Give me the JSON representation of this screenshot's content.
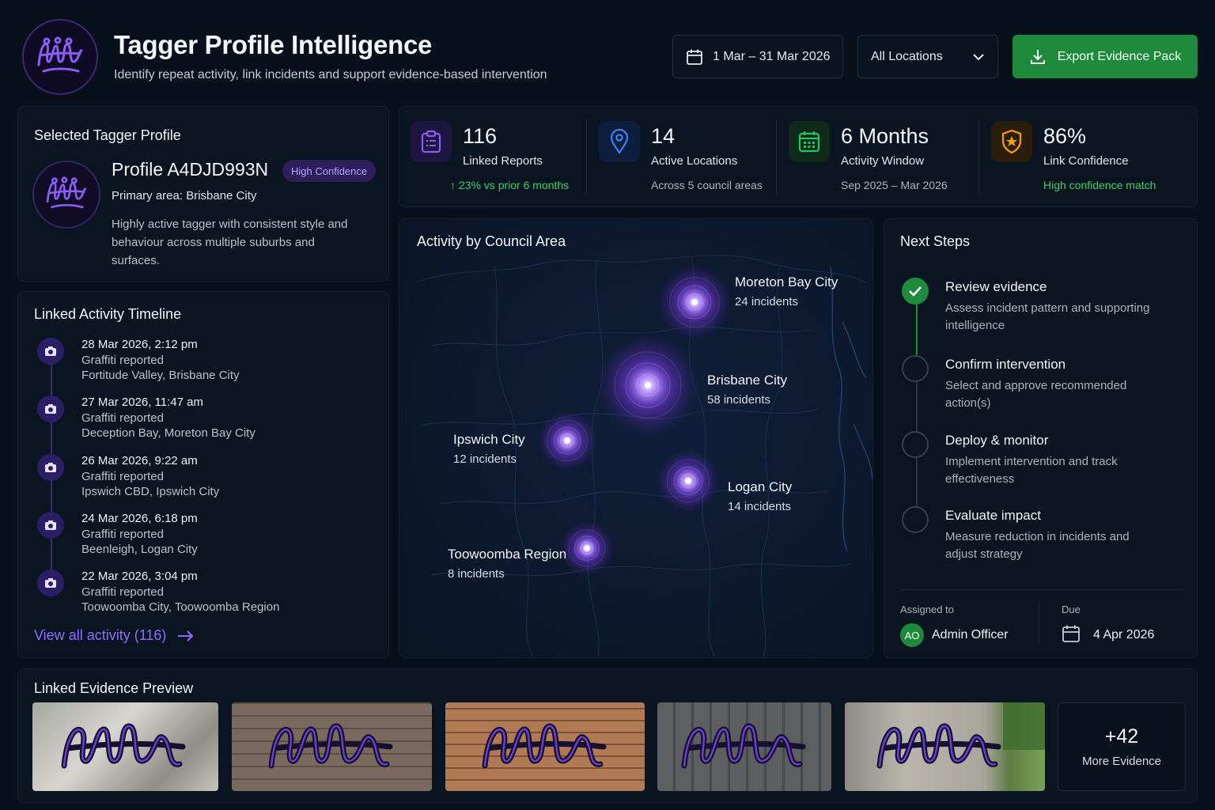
{
  "header": {
    "title": "Tagger Profile Intelligence",
    "subtitle": "Identify repeat activity, link incidents and support evidence-based intervention",
    "date_range": "1 Mar – 31 Mar 2026",
    "location_filter": "All Locations",
    "export_label": "Export Evidence Pack"
  },
  "profile": {
    "section_title": "Selected Tagger Profile",
    "name": "Profile A4DJD993N",
    "confidence_badge": "High Confidence",
    "primary_area": "Primary area: Brisbane City",
    "description": "Highly active tagger with consistent style and behaviour across multiple suburbs and surfaces."
  },
  "timeline": {
    "section_title": "Linked Activity Timeline",
    "items": [
      {
        "time": "28 Mar 2026, 2:12 pm",
        "type": "Graffiti reported",
        "location": "Fortitude Valley, Brisbane City"
      },
      {
        "time": "27 Mar 2026, 11:47 am",
        "type": "Graffiti reported",
        "location": "Deception Bay, Moreton Bay City"
      },
      {
        "time": "26 Mar 2026, 9:22 am",
        "type": "Graffiti reported",
        "location": "Ipswich CBD, Ipswich City"
      },
      {
        "time": "24 Mar 2026, 6:18 pm",
        "type": "Graffiti reported",
        "location": "Beenleigh, Logan City"
      },
      {
        "time": "22 Mar 2026, 3:04 pm",
        "type": "Graffiti reported",
        "location": "Toowoomba City, Toowoomba Region"
      }
    ],
    "view_all": "View all activity (116)"
  },
  "kpis": [
    {
      "value": "116",
      "label": "Linked Reports",
      "sub": "23% vs prior 6 months",
      "icon": "clipboard-icon",
      "color": "#8b5cf6"
    },
    {
      "value": "14",
      "label": "Active Locations",
      "sub": "Across 5 council areas",
      "icon": "map-pin-icon",
      "color": "#3b82f6"
    },
    {
      "value": "6 Months",
      "label": "Activity Window",
      "sub": "Sep 2025 – Mar 2026",
      "icon": "calendar-icon",
      "color": "#22c55e"
    },
    {
      "value": "86%",
      "label": "Link Confidence",
      "sub": "High confidence match",
      "icon": "shield-star-icon",
      "color": "#f59e0b"
    }
  ],
  "map": {
    "section_title": "Activity by Council Area",
    "areas": [
      {
        "name": "Moreton Bay City",
        "count": "24 incidents",
        "incidents": 24
      },
      {
        "name": "Brisbane City",
        "count": "58 incidents",
        "incidents": 58
      },
      {
        "name": "Ipswich City",
        "count": "12 incidents",
        "incidents": 12
      },
      {
        "name": "Logan City",
        "count": "14 incidents",
        "incidents": 14
      },
      {
        "name": "Toowoomba Region",
        "count": "8 incidents",
        "incidents": 8
      }
    ]
  },
  "next_steps": {
    "section_title": "Next Steps",
    "steps": [
      {
        "title": "Review evidence",
        "desc": "Assess incident pattern and supporting intelligence",
        "done": true
      },
      {
        "title": "Confirm intervention",
        "desc": "Select and approve recommended action(s)",
        "done": false
      },
      {
        "title": "Deploy & monitor",
        "desc": "Implement intervention and track effectiveness",
        "done": false
      },
      {
        "title": "Evaluate impact",
        "desc": "Measure reduction in incidents and adjust strategy",
        "done": false
      }
    ],
    "assigned_label": "Assigned to",
    "assignee_initials": "AO",
    "assignee_name": "Admin Officer",
    "due_label": "Due",
    "due_date": "4 Apr 2026"
  },
  "evidence": {
    "section_title": "Linked Evidence Preview",
    "more_count": "+42",
    "more_label": "More Evidence"
  },
  "colors": {
    "accent_purple": "#8f6cff",
    "success_green": "#1f8a3b",
    "background": "#07101b"
  }
}
